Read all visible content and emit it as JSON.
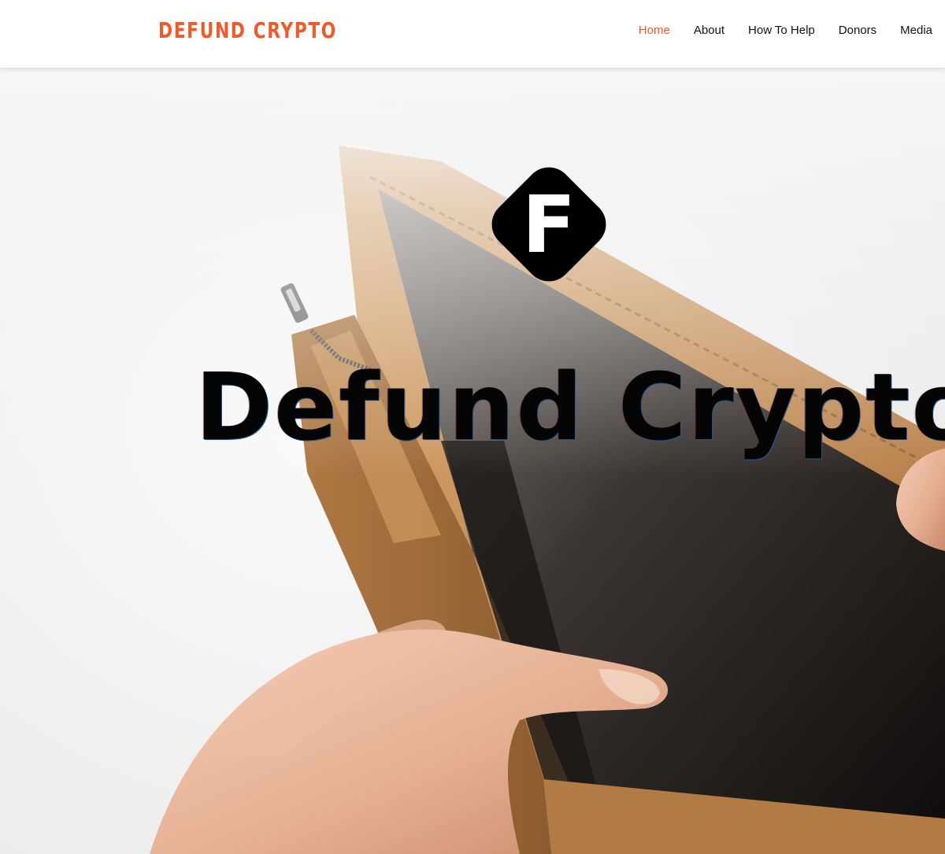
{
  "header": {
    "brand": "DEFUND CRYPTO",
    "nav": [
      {
        "label": "Home",
        "active": true
      },
      {
        "label": "About",
        "active": false
      },
      {
        "label": "How To Help",
        "active": false
      },
      {
        "label": "Donors",
        "active": false
      },
      {
        "label": "Media",
        "active": false
      }
    ]
  },
  "hero": {
    "logo_letter": "F",
    "title": "Defund Crypto",
    "image_subject": "empty-wallet-photo"
  },
  "colors": {
    "accent": "#f0592a",
    "text": "#111111",
    "header_bg": "#ffffff",
    "wallet_leather": "#c8955e",
    "wallet_lining": "#2e2a28"
  }
}
